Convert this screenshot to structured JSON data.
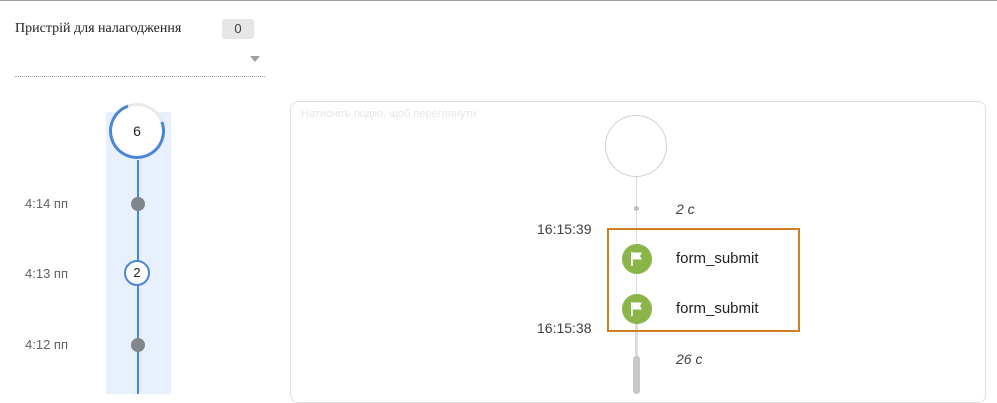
{
  "device": {
    "label": "Пристрій для налагодження",
    "count": "0",
    "selected": ""
  },
  "minutes": {
    "top_count": "6",
    "rows": [
      {
        "time": "4:14 пп",
        "count": ""
      },
      {
        "time": "4:13 пп",
        "count": "2"
      },
      {
        "time": "4:12 пп",
        "count": ""
      }
    ]
  },
  "events": {
    "panel_title": "Натисніть подію, щоб переглянути",
    "duration_top": "2 с",
    "timestamp_1": "16:15:39",
    "timestamp_2": "16:15:38",
    "duration_bottom": "26 с",
    "items": [
      {
        "name": "form_submit",
        "icon": "flag-icon"
      },
      {
        "name": "form_submit",
        "icon": "flag-icon"
      }
    ]
  },
  "colors": {
    "accent": "#4a86d8",
    "event_icon": "#8bb548",
    "highlight": "#d27f24",
    "minute_column": "#e8f0fe"
  }
}
